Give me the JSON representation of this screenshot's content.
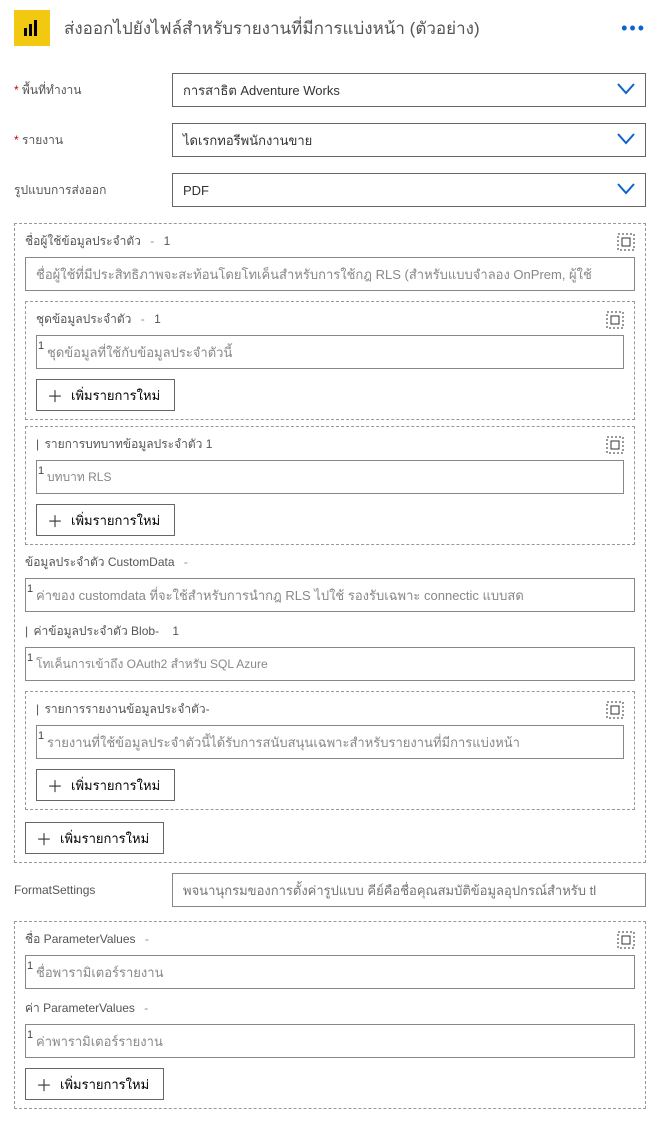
{
  "header": {
    "title": "ส่งออกไปยังไฟล์สำหรับรายงานที่มีการแบ่งหน้า (ตัวอย่าง)"
  },
  "labels": {
    "workspace": "พื้นที่ทำงาน",
    "report": "รายงาน",
    "exportFormat": "รูปแบบการส่งออก"
  },
  "selects": {
    "workspace": "การสาธิต Adventure Works",
    "report": "ไดเรกทอรีพนักงานขาย",
    "exportFormat": "PDF"
  },
  "sections": {
    "identityUser": {
      "label": "ชื่อผู้ใช้ข้อมูลประจำตัว",
      "idx": "1",
      "placeholder": "ชื่อผู้ใช้ที่มีประสิทธิภาพจะสะท้อนโดยโทเค็นสำหรับการใช้กฎ RLS (สำหรับแบบจำลอง OnPrem, ผู้ใช้"
    },
    "dataset": {
      "label": "ชุดข้อมูลประจำตัว",
      "idx": "1",
      "placeholder": "ชุดข้อมูลที่ใช้กับข้อมูลประจำตัวนี้"
    },
    "roles": {
      "label": "รายการบทบาทข้อมูลประจำตัว",
      "idx": "1",
      "placeholder": "บทบาท RLS"
    },
    "customData": {
      "label": "ข้อมูลประจำตัว CustomData",
      "placeholder": "ค่าของ customdata ที่จะใช้สำหรับการนำกฎ RLS ไปใช้ รองรับเฉพาะ connectic แบบสด"
    },
    "blob": {
      "label": "ค่าข้อมูลประจำตัว Blob-",
      "idx": "1",
      "placeholder": "โทเค็นการเข้าถึง OAuth2 สำหรับ SQL Azure"
    },
    "identityReports": {
      "label": "รายการรายงานข้อมูลประจำตัว-",
      "placeholder": "รายงานที่ใช้ข้อมูลประจำตัวนี้ได้รับการสนับสนุนเฉพาะสำหรับรายงานที่มีการแบ่งหน้า"
    },
    "formatSettings": {
      "label": "FormatSettings",
      "placeholder": "พจนานุกรมของการตั้งค่ารูปแบบ คีย์คือชื่อคุณสมบัติข้อมูลอุปกรณ์สำหรับ tl"
    },
    "paramName": {
      "label": "ชื่อ ParameterValues",
      "placeholder": "ชื่อพารามิเตอร์รายงาน"
    },
    "paramValue": {
      "label": "ค่า ParameterValues",
      "placeholder": "ค่าพารามิเตอร์รายงาน"
    }
  },
  "buttons": {
    "addNew": "เพิ่มรายการใหม่"
  }
}
